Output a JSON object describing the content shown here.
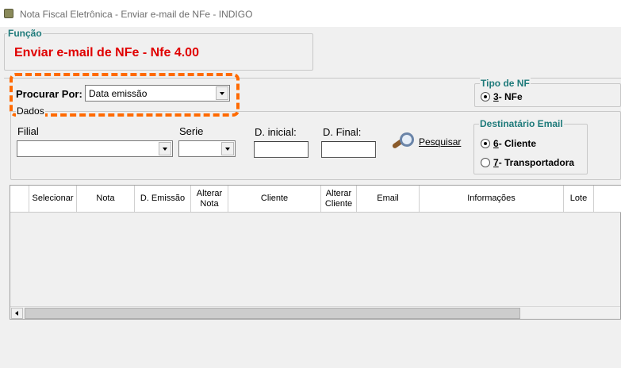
{
  "window": {
    "title": "Nota Fiscal Eletrônica - Enviar e-mail de NFe - INDIGO"
  },
  "funcao": {
    "legend": "Função",
    "title": "Enviar e-mail de NFe - Nfe 4.00"
  },
  "procurar": {
    "label": "Procurar Por:",
    "value": "Data emissão"
  },
  "tipo_nf": {
    "legend": "Tipo de NF",
    "option_key": "3",
    "option_label": " - NFe",
    "selected": true
  },
  "dados": {
    "legend": "Dados",
    "filial_label": "Filial",
    "filial_value": "",
    "serie_label": "Serie",
    "serie_value": "",
    "d_inicial_label": "D. inicial:",
    "d_inicial_value": "",
    "d_final_label": "D. Final:",
    "d_final_value": ""
  },
  "pesquisar": {
    "label": "Pesquisar",
    "icon": "magnifier-icon"
  },
  "destinatario": {
    "legend": "Destinatário Email",
    "options": [
      {
        "key": "6",
        "label": " - Cliente",
        "selected": true
      },
      {
        "key": "7",
        "label": " - Transportadora",
        "selected": false
      }
    ]
  },
  "grid": {
    "columns": [
      "Selecionar",
      "Nota",
      "D. Emissão",
      "Alterar\nNota",
      "Cliente",
      "Alterar\nCliente",
      "Email",
      "Informações",
      "Lote"
    ],
    "rows": []
  },
  "colors": {
    "accent_red": "#e00000",
    "legend_teal": "#1e7a7a",
    "highlight_orange": "#ff6a00"
  }
}
